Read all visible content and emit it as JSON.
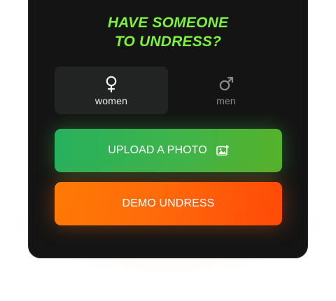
{
  "headline": {
    "line1": "HAVE SOMEONE",
    "line2": "TO UNDRESS?"
  },
  "gender_toggle": {
    "selected": "women",
    "options": [
      {
        "label": "women",
        "icon": "female-symbol-icon"
      },
      {
        "label": "men",
        "icon": "male-symbol-icon"
      }
    ]
  },
  "buttons": {
    "upload_label": "UPLOAD A PHOTO",
    "upload_icon": "image-icon",
    "demo_label": "DEMO UNDRESS"
  },
  "colors": {
    "card_bg": "#141414",
    "headline_green": "#7cf23c",
    "upload_green": "#3fb44a",
    "demo_orange": "#ff6a0a"
  }
}
